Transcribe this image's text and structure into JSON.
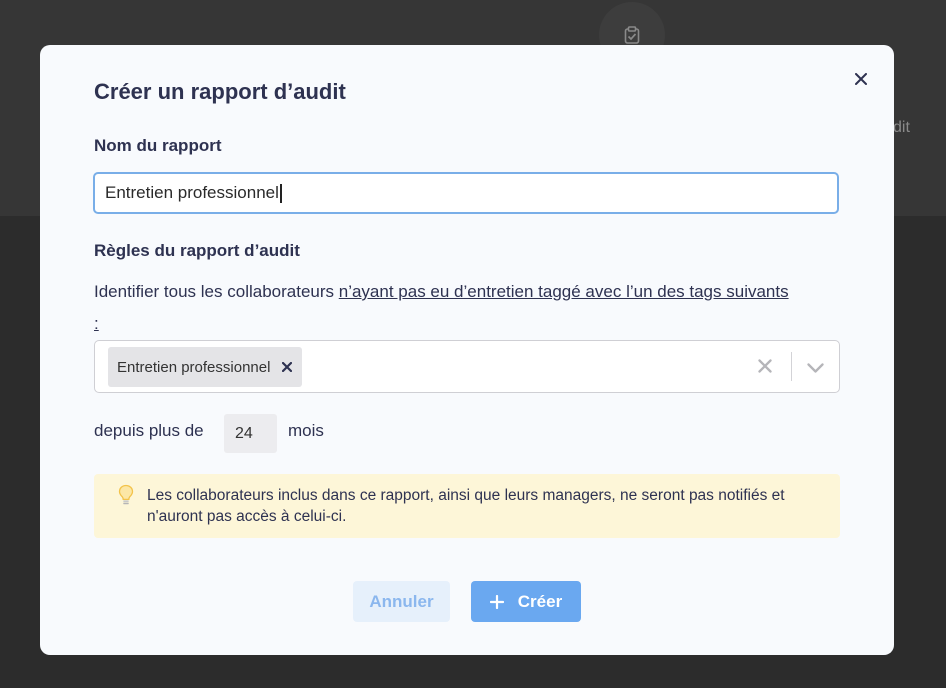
{
  "background": {
    "partial_text": "dit",
    "icon": "clipboard-check-icon"
  },
  "modal": {
    "title": "Créer un rapport d’audit",
    "close_icon": "close-icon",
    "name_label": "Nom du rapport",
    "name_value": "Entretien professionnel",
    "rules_label": "Règles du rapport d’audit",
    "rule_text_plain": "Identifier tous les collaborateurs ",
    "rule_text_underlined": "n’ayant pas eu d’entretien taggé avec l’un des tags suivants :",
    "selected_tags": [
      {
        "label": "Entretien professionnel"
      }
    ],
    "depuis_label": "depuis plus de",
    "months_value": "24",
    "months_unit": "mois",
    "info_icon": "lightbulb-icon",
    "info_text": "Les collaborateurs inclus dans ce rapport, ainsi que leurs managers, ne seront pas notifiés et n'auront pas accès à celui-ci.",
    "cancel_label": "Annuler",
    "create_label": "Créer"
  },
  "colors": {
    "title": "#2e3251",
    "primary": "#6aa8f0",
    "primary_light": "#e6f0fb",
    "info_bg": "#fdf6d8",
    "input_focus_border": "#79aee8"
  }
}
